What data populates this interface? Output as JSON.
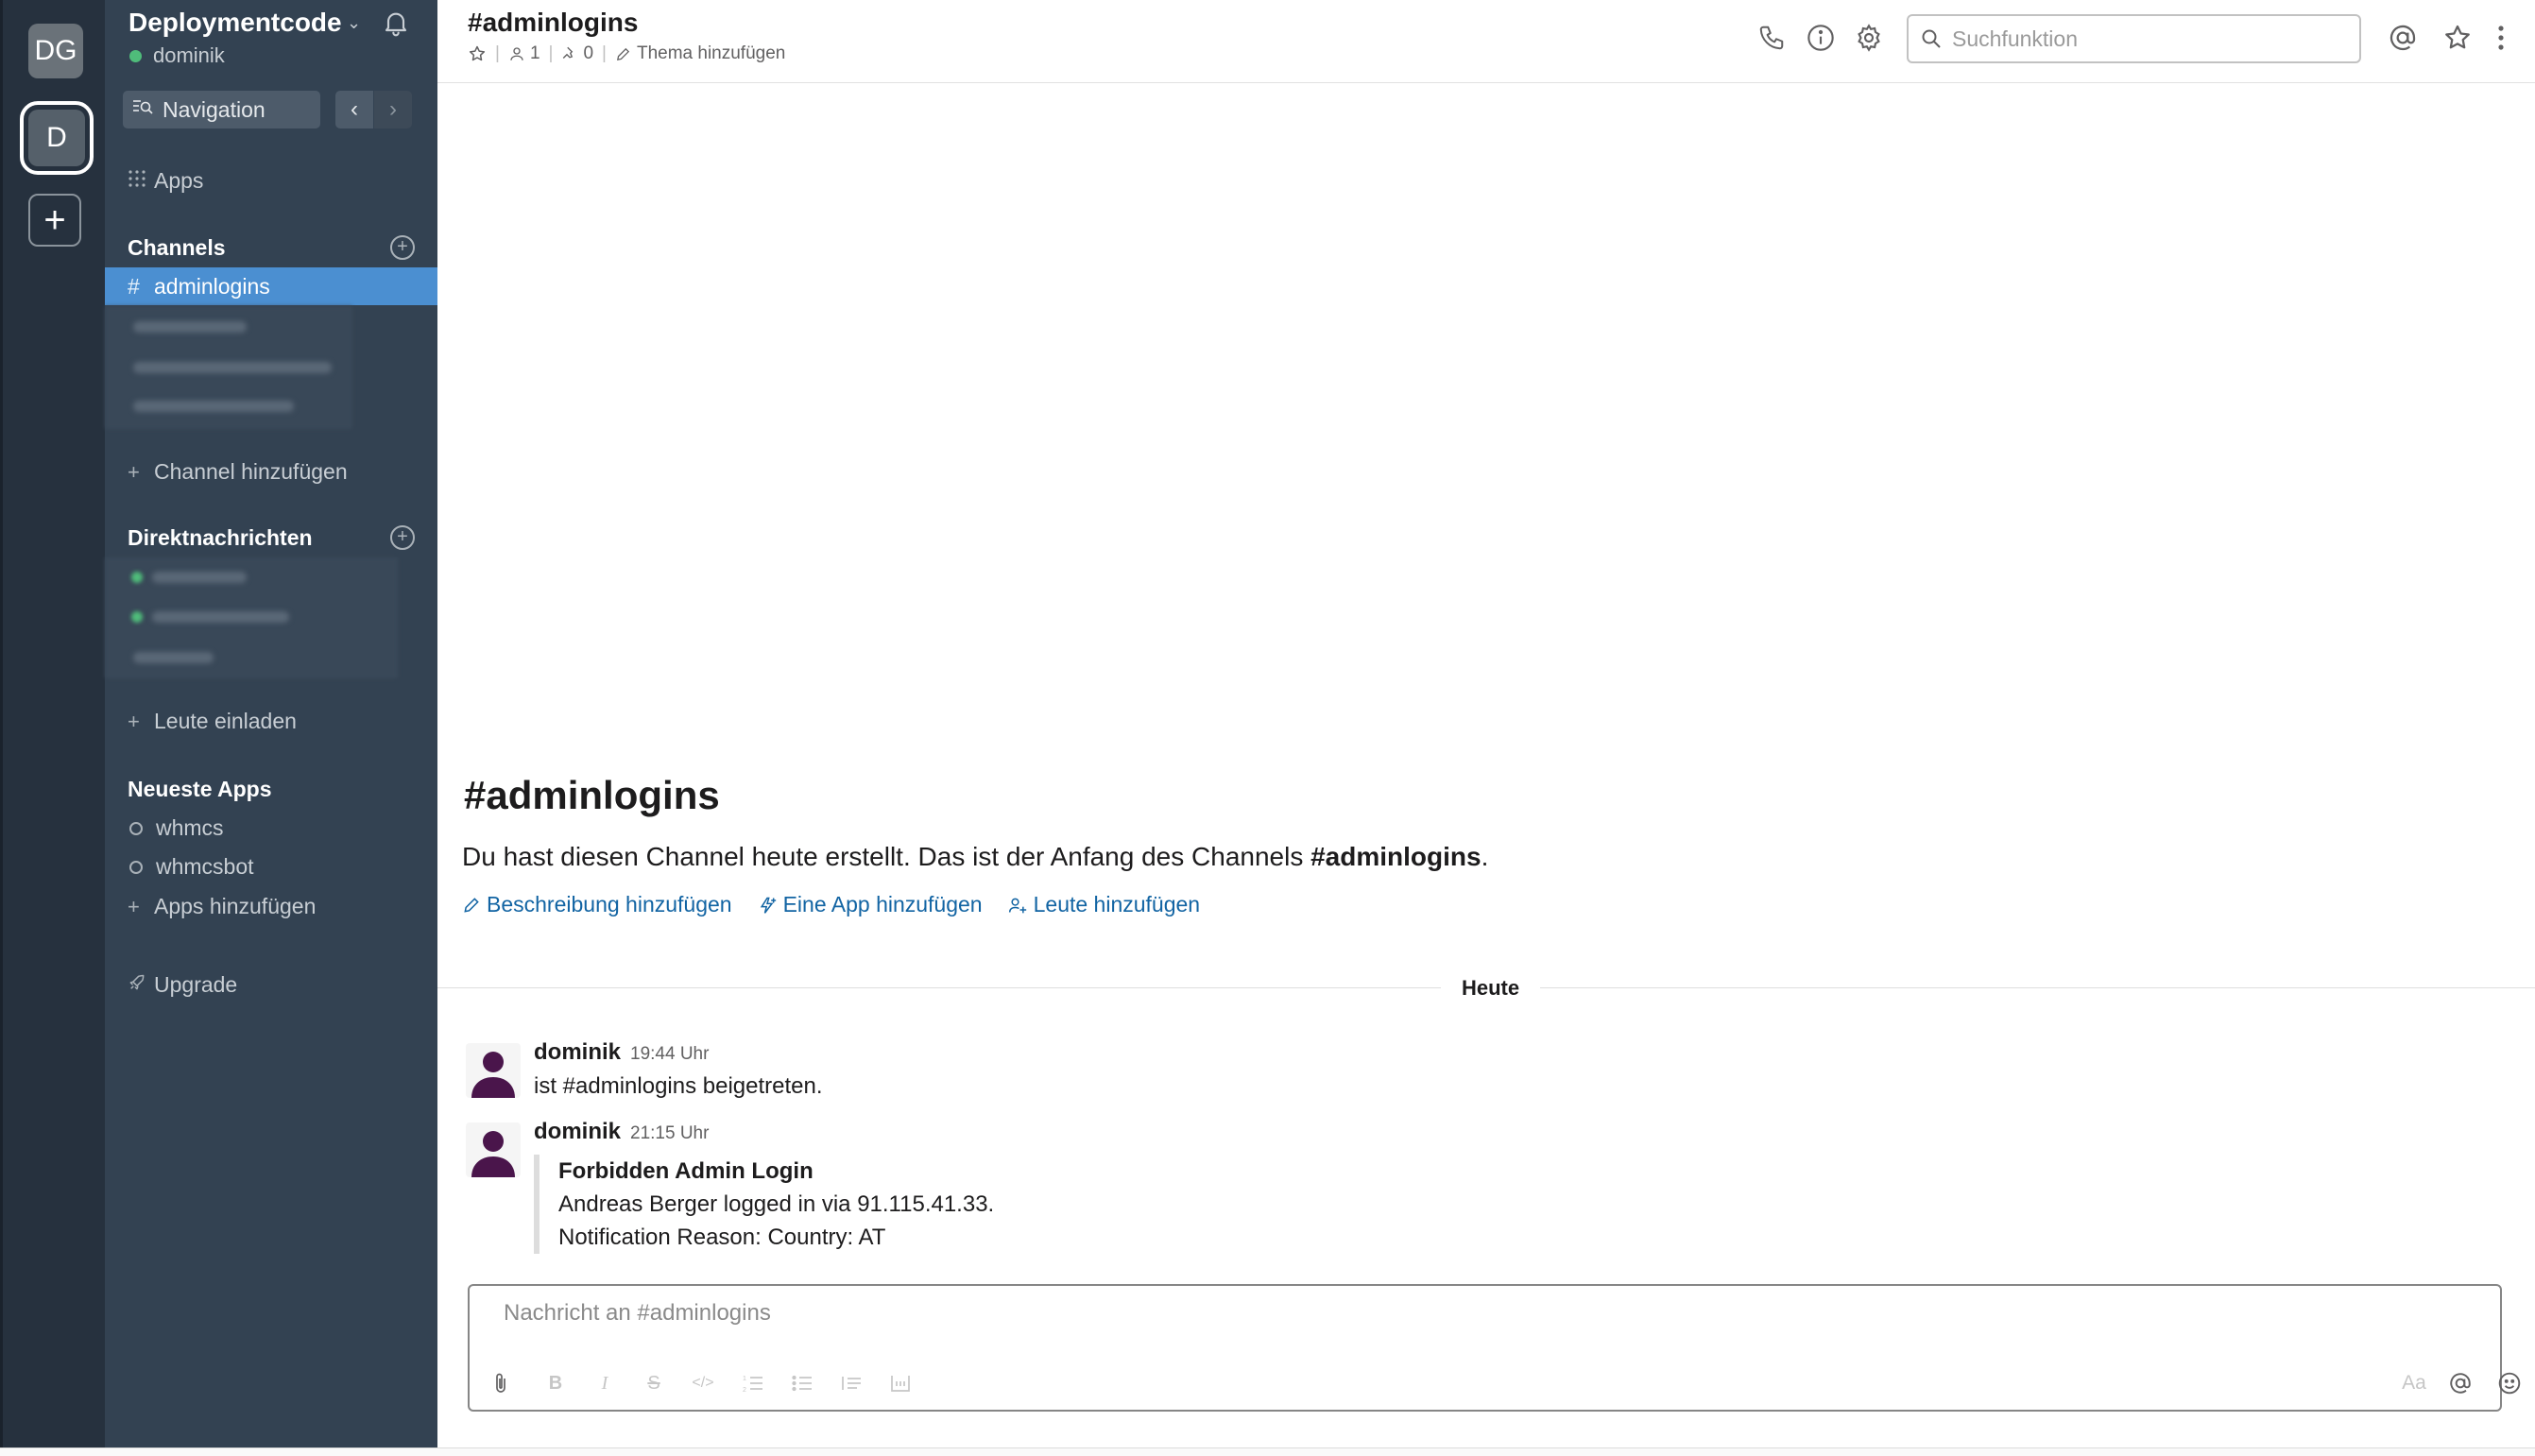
{
  "rail": {
    "workspaces": [
      {
        "label": "DG"
      },
      {
        "label": "D"
      }
    ],
    "add_label": "+"
  },
  "sidebar": {
    "team_name": "Deploymentcode",
    "user": "dominik",
    "navigation_label": "Navigation",
    "apps_label": "Apps",
    "channels_header": "Channels",
    "active_channel": "adminlogins",
    "add_channel_label": "Channel hinzufügen",
    "dm_header": "Direktnachrichten",
    "invite_label": "Leute einladen",
    "recent_apps_header": "Neueste Apps",
    "recent_apps": [
      "whmcs",
      "whmcsbot"
    ],
    "add_apps_label": "Apps hinzufügen",
    "upgrade_label": "Upgrade"
  },
  "header": {
    "channel_title": "#adminlogins",
    "members_count": "1",
    "pins_count": "0",
    "topic_label": "Thema hinzufügen",
    "search_placeholder": "Suchfunktion"
  },
  "intro": {
    "title": "#adminlogins",
    "text_prefix": "Du hast diesen Channel heute erstellt. Das ist der Anfang des Channels ",
    "text_channel": "#adminlogins",
    "text_suffix": ".",
    "links": [
      "Beschreibung hinzufügen",
      "Eine App hinzufügen",
      "Leute hinzufügen"
    ]
  },
  "day_divider": "Heute",
  "messages": [
    {
      "author": "dominik",
      "time": "19:44 Uhr",
      "text": "ist #adminlogins beigetreten."
    },
    {
      "author": "dominik",
      "time": "21:15 Uhr",
      "attachment": {
        "title": "Forbidden Admin Login",
        "line1": "Andreas Berger logged in via 91.115.41.33.",
        "line2": "Notification Reason: Country: AT"
      }
    }
  ],
  "composer": {
    "placeholder": "Nachricht an #adminlogins",
    "aa_label": "Aa"
  },
  "colors": {
    "sidebar_bg": "#334252",
    "rail_bg": "#26313e",
    "active_channel_bg": "#4b8fd1",
    "link": "#1264a3",
    "presence": "#4fbc7a",
    "avatar": "#4a154b"
  }
}
